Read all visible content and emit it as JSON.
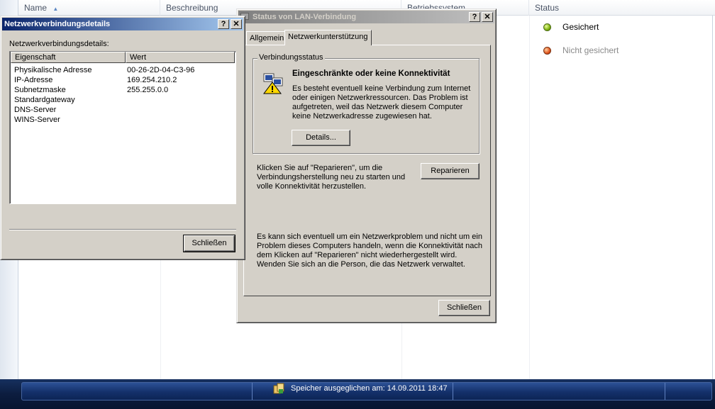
{
  "background": {
    "columns": [
      "Name",
      "Beschreibung",
      "Betriebssystem",
      "Status"
    ],
    "status_rows": [
      {
        "label": "Gesichert",
        "state": "ok"
      },
      {
        "label": "Nicht gesichert",
        "state": "error"
      }
    ]
  },
  "taskbar": {
    "message": "Speicher ausgeglichen am: 14.09.2011 18:47"
  },
  "details_window": {
    "title": "Netzwerkverbindungsdetails",
    "help": "?",
    "close": "✕",
    "caption": "Netzwerkverbindungsdetails:",
    "headers": [
      "Eigenschaft",
      "Wert"
    ],
    "rows": [
      {
        "name": "Physikalische Adresse",
        "value": "00-26-2D-04-C3-96"
      },
      {
        "name": "IP-Adresse",
        "value": "169.254.210.2"
      },
      {
        "name": "Subnetzmaske",
        "value": "255.255.0.0"
      },
      {
        "name": "Standardgateway",
        "value": ""
      },
      {
        "name": "DNS-Server",
        "value": ""
      },
      {
        "name": "WINS-Server",
        "value": ""
      }
    ],
    "close_button": "Schließen"
  },
  "status_window": {
    "title": "Status von LAN-Verbindung",
    "help": "?",
    "close": "✕",
    "tabs": [
      "Allgemein",
      "Netzwerkunterstützung"
    ],
    "group_label": "Verbindungsstatus",
    "heading": "Eingeschränkte oder keine Konnektivität",
    "description_lines": [
      "Es besteht eventuell keine Verbindung zum Internet",
      "oder einigen Netzwerkressourcen. Das Problem ist",
      "aufgetreten, weil das Netzwerk diesem Computer",
      "keine Netzwerkadresse zugewiesen hat."
    ],
    "details_button": "Details...",
    "repair_text_lines": [
      "Klicken Sie auf \"Reparieren\", um die",
      "Verbindungsherstellung neu zu starten und",
      "volle Konnektivität herzustellen."
    ],
    "repair_button": "Reparieren",
    "note_lines": [
      "Es kann sich eventuell um ein Netzwerkproblem und nicht um ein",
      "Problem dieses Computers handeln, wenn die Konnektivität nach",
      "dem Klicken auf \"Reparieren\" nicht wiederhergestellt wird.",
      "Wenden Sie sich an die Person, die das Netzwerk verwaltet."
    ],
    "close_button": "Schließen"
  },
  "colors": {
    "active_title": "#0a246a",
    "inactive_title": "#808080",
    "taskbar": "#0c1d3f"
  },
  "icons": [
    "sort-ascending-icon",
    "status-ok-icon",
    "status-error-icon",
    "network-warning-icon",
    "backup-icon"
  ]
}
